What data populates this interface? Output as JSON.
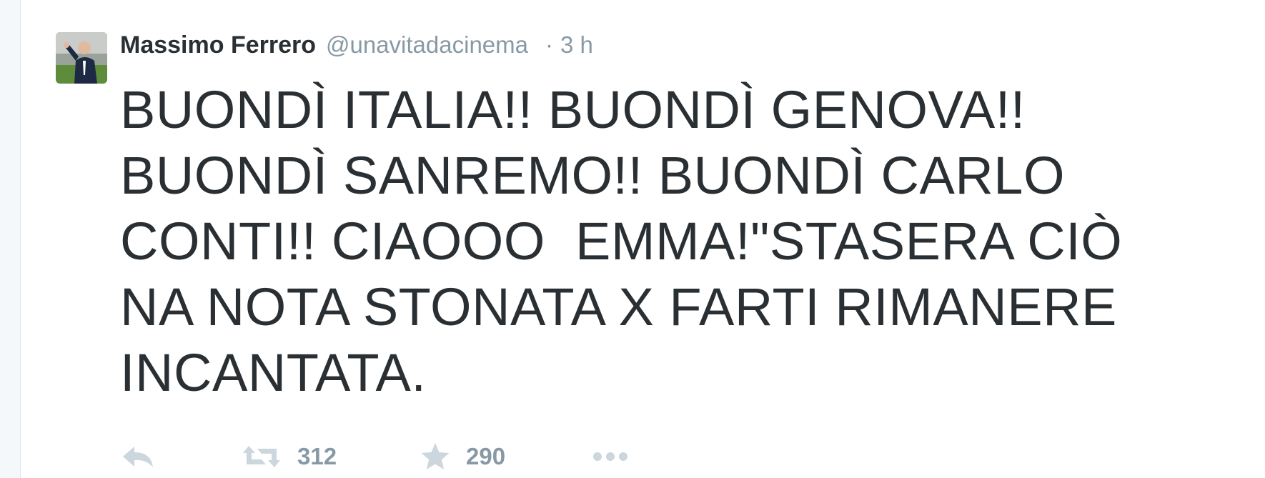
{
  "tweet": {
    "author_name": "Massimo Ferrero",
    "author_handle": "@unavitadacinema",
    "separator": "·",
    "timestamp": "3 h",
    "text": "BUONDÌ ITALIA!! BUONDÌ GENOVA!!\nBUONDÌ SANREMO!! BUONDÌ CARLO\nCONTI!! CIAOOO  EMMA!\"STASERA CIÒ\nNA NOTA STONATA X FARTI RIMANERE\nINCANTATA."
  },
  "actions": {
    "reply_icon": "reply-icon",
    "retweet_icon": "retweet-icon",
    "retweet_count": "312",
    "favorite_icon": "star-icon",
    "favorite_count": "290",
    "more_icon": "more-icon"
  },
  "colors": {
    "text": "#292f33",
    "muted": "#8899a6",
    "icon": "#ccd6dd"
  }
}
